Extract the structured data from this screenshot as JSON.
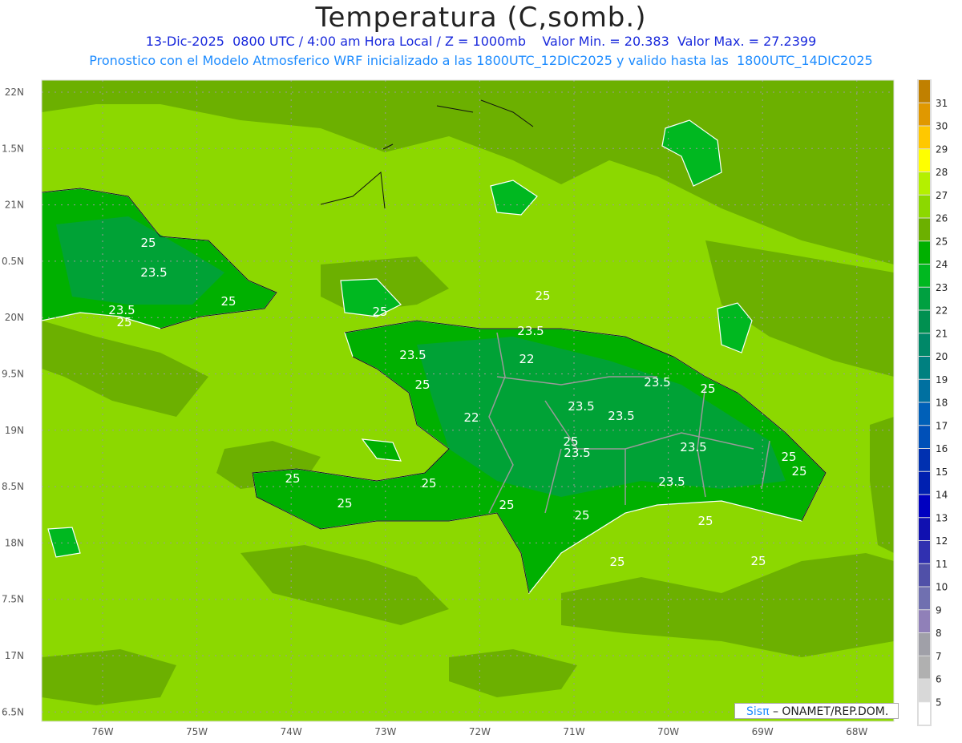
{
  "header": {
    "title": "Temperatura (C,somb.)",
    "line1": "13-Dic-2025  0800 UTC / 4:00 am Hora Local / Z = 1000mb    Valor Min. = 20.383  Valor Max. = 27.2399",
    "line2": "Pronostico con el Modelo Atmosferico WRF inicializado a las 1800UTC_12DIC2025 y valido hasta las  1800UTC_14DIC2025"
  },
  "axes": {
    "lat_labels": [
      "22N",
      "1.5N",
      "21N",
      "0.5N",
      "20N",
      "9.5N",
      "19N",
      "8.5N",
      "18N",
      "7.5N",
      "17N",
      "6.5N"
    ],
    "lon_labels": [
      "76W",
      "75W",
      "74W",
      "73W",
      "72W",
      "71W",
      "70W",
      "69W",
      "68W"
    ]
  },
  "colorbar": {
    "labels": [
      "31",
      "30",
      "29",
      "28",
      "27",
      "26",
      "25",
      "24",
      "23",
      "22",
      "21",
      "20",
      "19",
      "18",
      "17",
      "16",
      "15",
      "14",
      "13",
      "12",
      "11",
      "10",
      "9",
      "8",
      "7",
      "6",
      "5"
    ],
    "colors": [
      "#c08000",
      "#e09800",
      "#ffc800",
      "#ffff00",
      "#b4f000",
      "#8cd800",
      "#6cb000",
      "#00b000",
      "#00b820",
      "#00a040",
      "#009050",
      "#008868",
      "#008080",
      "#0070a0",
      "#0060b8",
      "#0050b8",
      "#0030b0",
      "#0020b0",
      "#0000c0",
      "#1010b0",
      "#3030b0",
      "#5050a8",
      "#7070b0",
      "#9080b8",
      "#a0a0a8",
      "#b0b0b0",
      "#d8d8d8",
      "#ffffff"
    ]
  },
  "contour_labels": [
    "25",
    "23.5",
    "25",
    "23.5",
    "25",
    "25",
    "25",
    "25",
    "23.5",
    "22",
    "23.5",
    "25",
    "23.5",
    "22",
    "23.5",
    "23.5",
    "25",
    "23.5",
    "23.5",
    "25",
    "25",
    "23.5",
    "25",
    "25",
    "25",
    "25",
    "25",
    "25",
    "25",
    "25"
  ],
  "credit": {
    "brand": "Sisπ",
    "text": " – ONAMET/REP.DOM."
  }
}
